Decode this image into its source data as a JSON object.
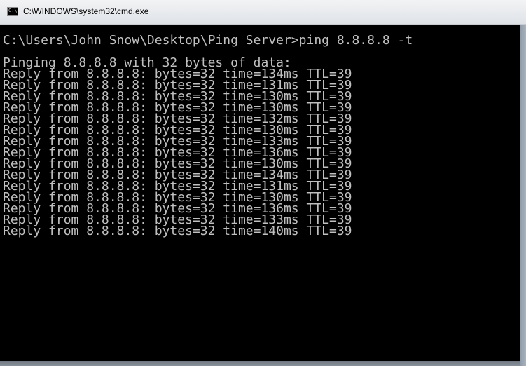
{
  "window": {
    "title": "C:\\WINDOWS\\system32\\cmd.exe",
    "icon_text": "C:\\"
  },
  "console": {
    "prompt": "C:\\Users\\John Snow\\Desktop\\Ping Server>ping 8.8.8.8 -t",
    "header": "Pinging 8.8.8.8 with 32 bytes of data:",
    "replies": [
      "Reply from 8.8.8.8: bytes=32 time=134ms TTL=39",
      "Reply from 8.8.8.8: bytes=32 time=131ms TTL=39",
      "Reply from 8.8.8.8: bytes=32 time=130ms TTL=39",
      "Reply from 8.8.8.8: bytes=32 time=130ms TTL=39",
      "Reply from 8.8.8.8: bytes=32 time=132ms TTL=39",
      "Reply from 8.8.8.8: bytes=32 time=130ms TTL=39",
      "Reply from 8.8.8.8: bytes=32 time=133ms TTL=39",
      "Reply from 8.8.8.8: bytes=32 time=136ms TTL=39",
      "Reply from 8.8.8.8: bytes=32 time=130ms TTL=39",
      "Reply from 8.8.8.8: bytes=32 time=134ms TTL=39",
      "Reply from 8.8.8.8: bytes=32 time=131ms TTL=39",
      "Reply from 8.8.8.8: bytes=32 time=130ms TTL=39",
      "Reply from 8.8.8.8: bytes=32 time=136ms TTL=39",
      "Reply from 8.8.8.8: bytes=32 time=133ms TTL=39",
      "Reply from 8.8.8.8: bytes=32 time=140ms TTL=39"
    ]
  }
}
